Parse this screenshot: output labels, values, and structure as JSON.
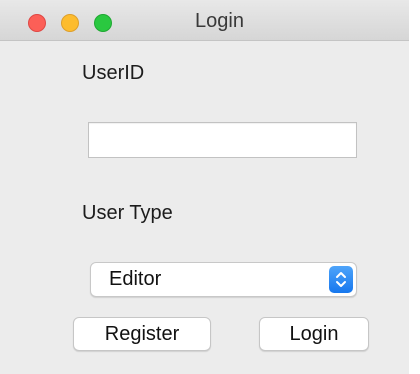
{
  "window": {
    "title": "Login"
  },
  "form": {
    "userid_label": "UserID",
    "userid_value": "",
    "usertype_label": "User Type",
    "usertype_selected": "Editor"
  },
  "buttons": {
    "register_label": "Register",
    "login_label": "Login"
  },
  "icons": {
    "close": "close-traffic-light",
    "minimize": "minimize-traffic-light",
    "zoom": "zoom-traffic-light",
    "stepper": "up-down-chevron-icon"
  },
  "colors": {
    "close": "#fc5f57",
    "minimize": "#fdbc2e",
    "zoom": "#2ac840",
    "accent": "#1677ee"
  }
}
